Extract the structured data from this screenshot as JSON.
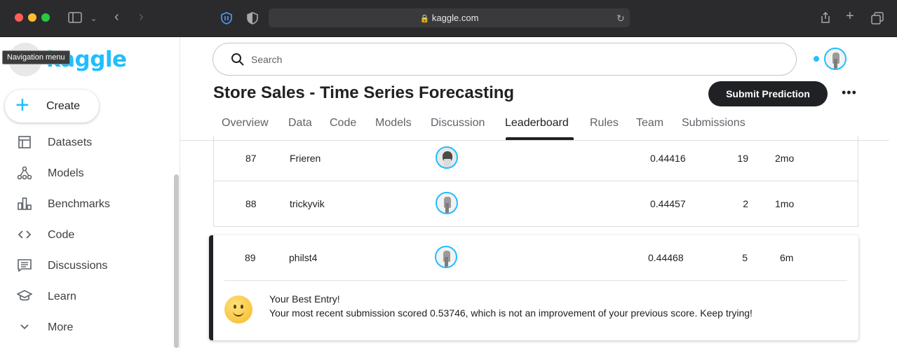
{
  "browser": {
    "url": "kaggle.com"
  },
  "sidebar": {
    "logo": "kaggle",
    "tooltip": "Navigation menu",
    "create_label": "Create",
    "items": [
      {
        "label": "Datasets",
        "icon": "table-icon"
      },
      {
        "label": "Models",
        "icon": "models-icon"
      },
      {
        "label": "Benchmarks",
        "icon": "bar-chart-icon"
      },
      {
        "label": "Code",
        "icon": "code-icon"
      },
      {
        "label": "Discussions",
        "icon": "comments-icon"
      },
      {
        "label": "Learn",
        "icon": "school-icon"
      },
      {
        "label": "More",
        "icon": "chevron-down-icon"
      }
    ]
  },
  "search": {
    "placeholder": "Search"
  },
  "competition": {
    "title": "Store Sales - Time Series Forecasting",
    "submit_label": "Submit Prediction",
    "more_label": "•••"
  },
  "tabs": [
    {
      "label": "Overview"
    },
    {
      "label": "Data"
    },
    {
      "label": "Code"
    },
    {
      "label": "Models"
    },
    {
      "label": "Discussion"
    },
    {
      "label": "Leaderboard",
      "active": true
    },
    {
      "label": "Rules"
    },
    {
      "label": "Team"
    },
    {
      "label": "Submissions"
    }
  ],
  "leaderboard": {
    "rows": [
      {
        "rank": "87",
        "name": "Frieren",
        "score": "0.44416",
        "entries": "19",
        "last": "2mo"
      },
      {
        "rank": "88",
        "name": "trickyvik",
        "score": "0.44457",
        "entries": "2",
        "last": "1mo"
      }
    ],
    "best": {
      "rank": "89",
      "name": "philst4",
      "score": "0.44468",
      "entries": "5",
      "last": "6m"
    }
  },
  "best_entry": {
    "title": "Your Best Entry!",
    "message": "Your most recent submission scored 0.53746, which is not an improvement of your previous score. Keep trying!"
  }
}
